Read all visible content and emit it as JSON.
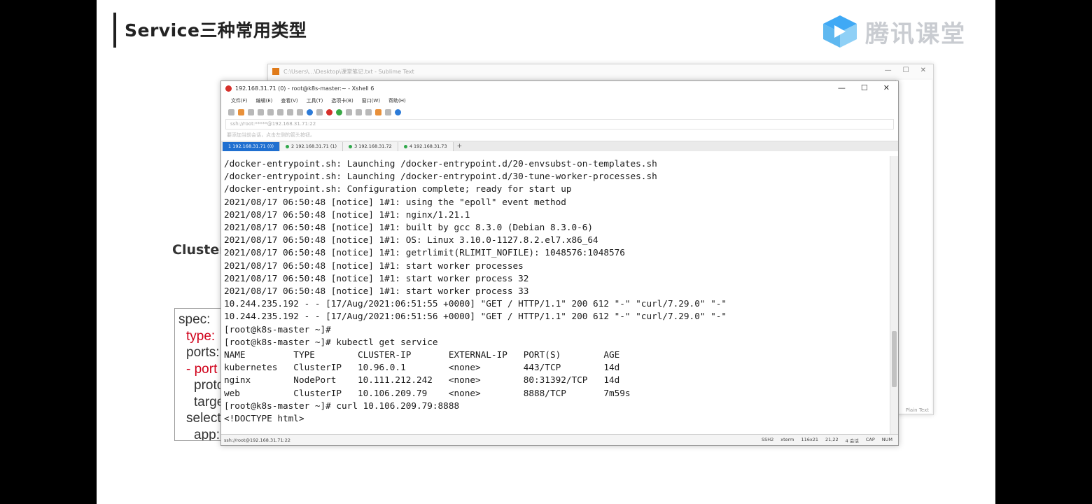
{
  "slide": {
    "title": "Service三种常用类型",
    "logo_text": "腾讯课堂",
    "side_label": "ClusterI",
    "spec_lines": [
      {
        "text": "spec:",
        "red": false,
        "indent": 0
      },
      {
        "text": "type:",
        "red": true,
        "indent": 1
      },
      {
        "text": "ports:",
        "red": false,
        "indent": 1
      },
      {
        "text": "- port",
        "red": true,
        "indent": 1
      },
      {
        "text": "proto",
        "red": false,
        "indent": 2
      },
      {
        "text": "targe",
        "red": false,
        "indent": 2
      },
      {
        "text": "select",
        "red": false,
        "indent": 1
      },
      {
        "text": "app:",
        "red": false,
        "indent": 2
      }
    ]
  },
  "sublime": {
    "title": "C:\\Users\\...\\Desktop\\课堂笔记.txt - Sublime Text",
    "status": "Plain Text"
  },
  "xshell": {
    "title": "192.168.31.71 (0) - root@k8s-master:~ - Xshell 6",
    "win_controls": [
      "—",
      "☐",
      "✕"
    ],
    "menu": [
      "文件(F)",
      "编辑(E)",
      "查看(V)",
      "工具(T)",
      "选项卡(B)",
      "窗口(W)",
      "帮助(H)"
    ],
    "address": "ssh://root:*****@192.168.31.71:22",
    "hint": "要添加当前会话，点击左侧的箭头按钮。",
    "tabs": [
      {
        "label": "1 192.168.31.71 (0)",
        "active": true
      },
      {
        "label": "2 192.168.31.71 (1)",
        "active": false
      },
      {
        "label": "3 192.168.31.72",
        "active": false
      },
      {
        "label": "4 192.168.31.73",
        "active": false
      }
    ],
    "tab_add": "+",
    "terminal_lines": [
      "/docker-entrypoint.sh: Launching /docker-entrypoint.d/20-envsubst-on-templates.sh",
      "/docker-entrypoint.sh: Launching /docker-entrypoint.d/30-tune-worker-processes.sh",
      "/docker-entrypoint.sh: Configuration complete; ready for start up",
      "2021/08/17 06:50:48 [notice] 1#1: using the \"epoll\" event method",
      "2021/08/17 06:50:48 [notice] 1#1: nginx/1.21.1",
      "2021/08/17 06:50:48 [notice] 1#1: built by gcc 8.3.0 (Debian 8.3.0-6)",
      "2021/08/17 06:50:48 [notice] 1#1: OS: Linux 3.10.0-1127.8.2.el7.x86_64",
      "2021/08/17 06:50:48 [notice] 1#1: getrlimit(RLIMIT_NOFILE): 1048576:1048576",
      "2021/08/17 06:50:48 [notice] 1#1: start worker processes",
      "2021/08/17 06:50:48 [notice] 1#1: start worker process 32",
      "2021/08/17 06:50:48 [notice] 1#1: start worker process 33",
      "10.244.235.192 - - [17/Aug/2021:06:51:55 +0000] \"GET / HTTP/1.1\" 200 612 \"-\" \"curl/7.29.0\" \"-\"",
      "10.244.235.192 - - [17/Aug/2021:06:51:56 +0000] \"GET / HTTP/1.1\" 200 612 \"-\" \"curl/7.29.0\" \"-\"",
      "[root@k8s-master ~]#",
      "[root@k8s-master ~]# kubectl get service",
      "NAME         TYPE        CLUSTER-IP       EXTERNAL-IP   PORT(S)        AGE",
      "kubernetes   ClusterIP   10.96.0.1        <none>        443/TCP        14d",
      "nginx        NodePort    10.111.212.242   <none>        80:31392/TCP   14d",
      "web          ClusterIP   10.106.209.79    <none>        8888/TCP       7m59s",
      "[root@k8s-master ~]# curl 10.106.209.79:8888",
      "<!DOCTYPE html>"
    ],
    "status_left": "ssh://root@192.168.31.71:22",
    "status_right": [
      "SSH2",
      "xterm",
      "116x21",
      "21,22",
      "4 会话",
      "CAP",
      "NUM"
    ]
  }
}
